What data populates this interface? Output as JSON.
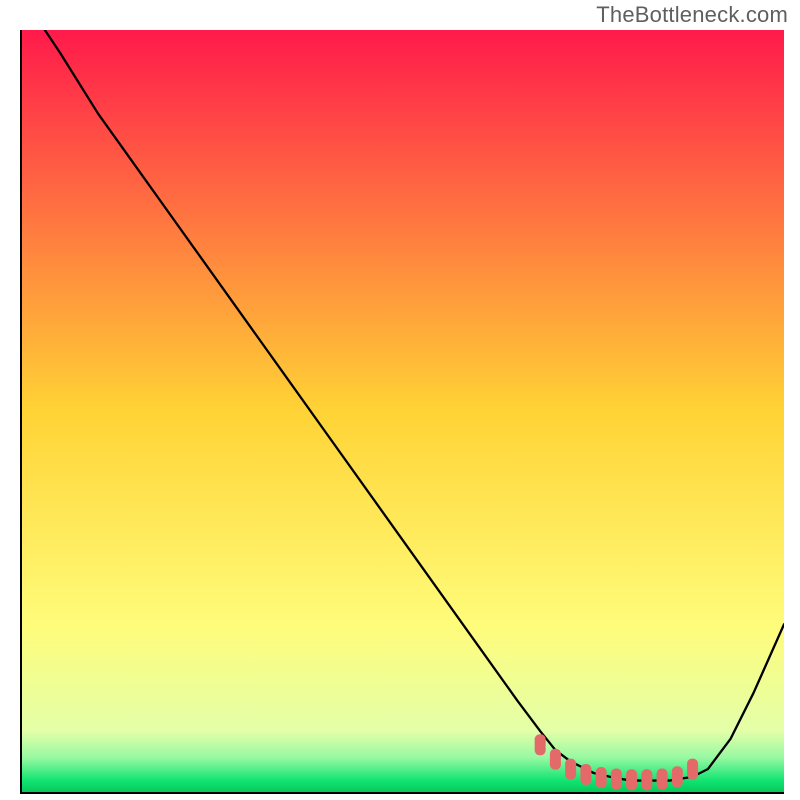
{
  "watermark": "TheBottleneck.com",
  "chart_data": {
    "type": "line",
    "title": "",
    "xlabel": "",
    "ylabel": "",
    "xlim": [
      0,
      100
    ],
    "ylim": [
      0,
      100
    ],
    "background_gradient": {
      "stops": [
        {
          "offset": 0.0,
          "color": "#ff1a4b"
        },
        {
          "offset": 0.5,
          "color": "#ffd335"
        },
        {
          "offset": 0.78,
          "color": "#fffc7a"
        },
        {
          "offset": 0.92,
          "color": "#e3ffa8"
        },
        {
          "offset": 0.955,
          "color": "#97f9a2"
        },
        {
          "offset": 0.985,
          "color": "#11e472"
        },
        {
          "offset": 1.0,
          "color": "#07c85d"
        }
      ]
    },
    "series": [
      {
        "name": "bottleneck-curve",
        "stroke": "#000000",
        "x": [
          3,
          5,
          10,
          20,
          30,
          40,
          50,
          60,
          65,
          68,
          70,
          72,
          75,
          78,
          80,
          82,
          85,
          88,
          90,
          93,
          96,
          100
        ],
        "y": [
          100,
          97,
          89,
          75,
          61,
          47,
          33,
          19,
          12,
          8,
          5.5,
          4,
          2.5,
          1.8,
          1.5,
          1.5,
          1.5,
          2,
          3,
          7,
          13,
          22
        ]
      },
      {
        "name": "optimal-markers",
        "type": "marker",
        "stroke": "#e46a6a",
        "fill": "#e46a6a",
        "x": [
          68,
          70,
          72,
          74,
          76,
          78,
          80,
          82,
          84,
          86,
          88
        ],
        "y": [
          6.2,
          4.3,
          3.0,
          2.3,
          1.9,
          1.7,
          1.6,
          1.6,
          1.7,
          2.0,
          3.0
        ]
      }
    ],
    "grid": false,
    "legend": false
  }
}
